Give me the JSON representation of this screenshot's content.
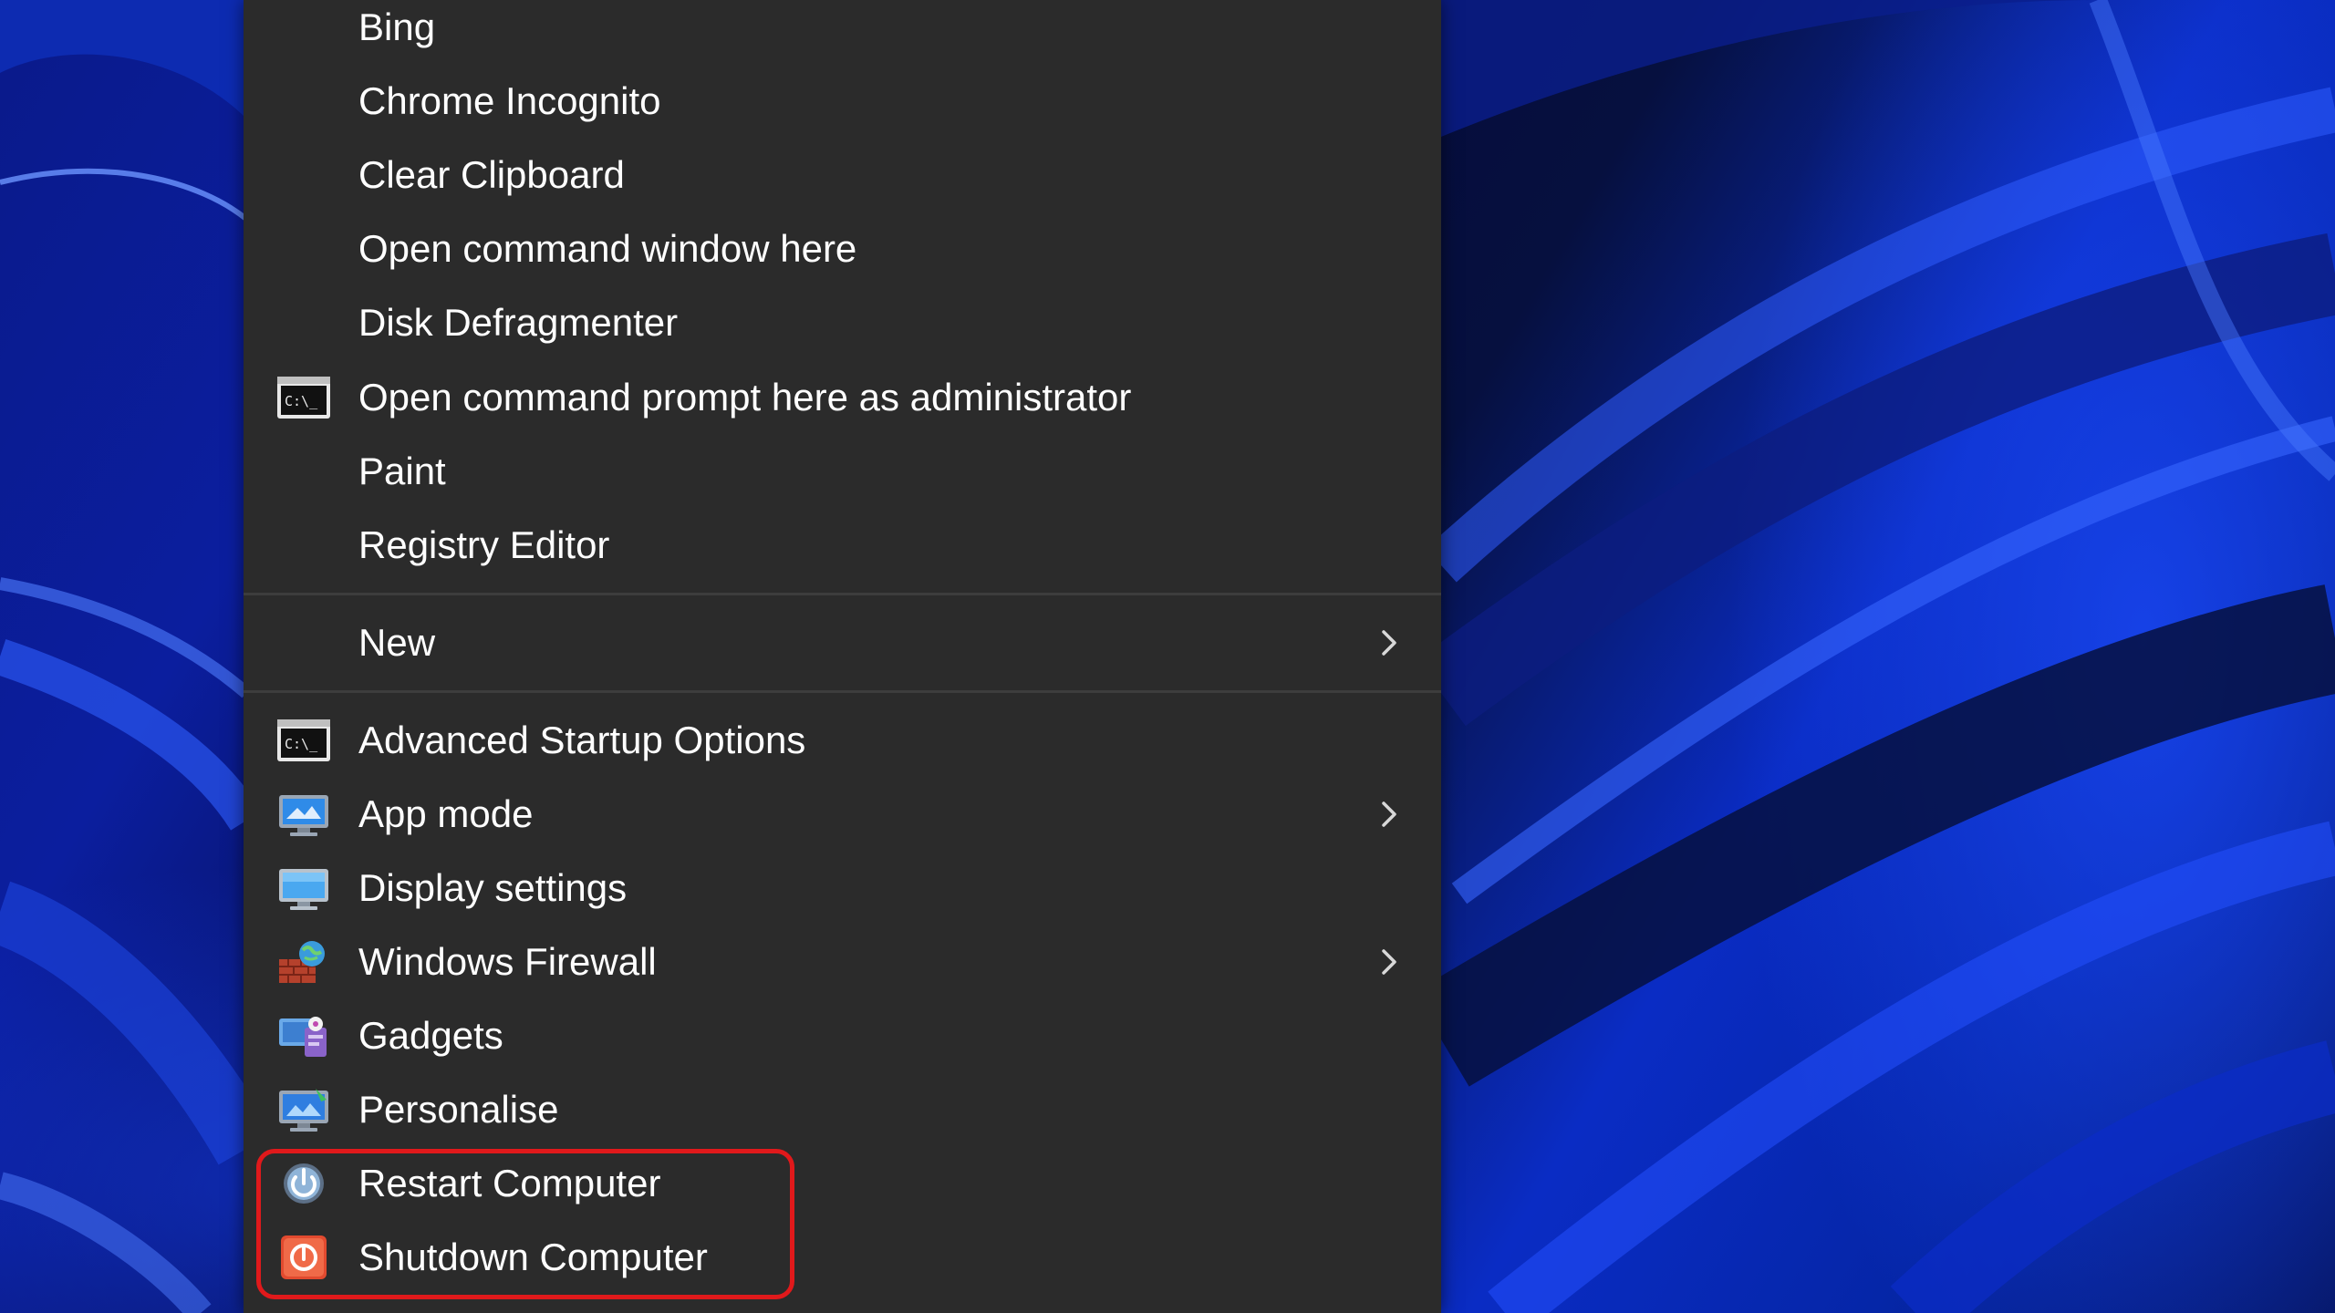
{
  "menu": {
    "items_top": [
      {
        "label": "Bing",
        "icon": "none"
      },
      {
        "label": "Chrome Incognito",
        "icon": "none"
      },
      {
        "label": "Clear Clipboard",
        "icon": "none"
      },
      {
        "label": "Open command window here",
        "icon": "none"
      },
      {
        "label": "Disk Defragmenter",
        "icon": "none"
      },
      {
        "label": "Open command prompt here as administrator",
        "icon": "cmd-icon"
      },
      {
        "label": "Paint",
        "icon": "none"
      },
      {
        "label": "Registry Editor",
        "icon": "none"
      }
    ],
    "new_item": {
      "label": "New",
      "has_submenu": true
    },
    "items_bottom": [
      {
        "label": "Advanced Startup Options",
        "icon": "cmd-icon",
        "has_submenu": false
      },
      {
        "label": "App mode",
        "icon": "monitor-icon",
        "has_submenu": true
      },
      {
        "label": "Display settings",
        "icon": "display-icon",
        "has_submenu": false
      },
      {
        "label": "Windows Firewall",
        "icon": "firewall-icon",
        "has_submenu": true
      },
      {
        "label": "Gadgets",
        "icon": "gadgets-icon",
        "has_submenu": false
      },
      {
        "label": "Personalise",
        "icon": "personalise-icon",
        "has_submenu": false
      },
      {
        "label": "Restart Computer",
        "icon": "restart-icon",
        "has_submenu": false
      },
      {
        "label": "Shutdown Computer",
        "icon": "shutdown-icon",
        "has_submenu": false
      }
    ]
  },
  "colors": {
    "menu_background": "#2b2b2b",
    "menu_text": "#ffffff",
    "separator": "#3d3d3d",
    "highlight_outline": "#e0191b"
  }
}
